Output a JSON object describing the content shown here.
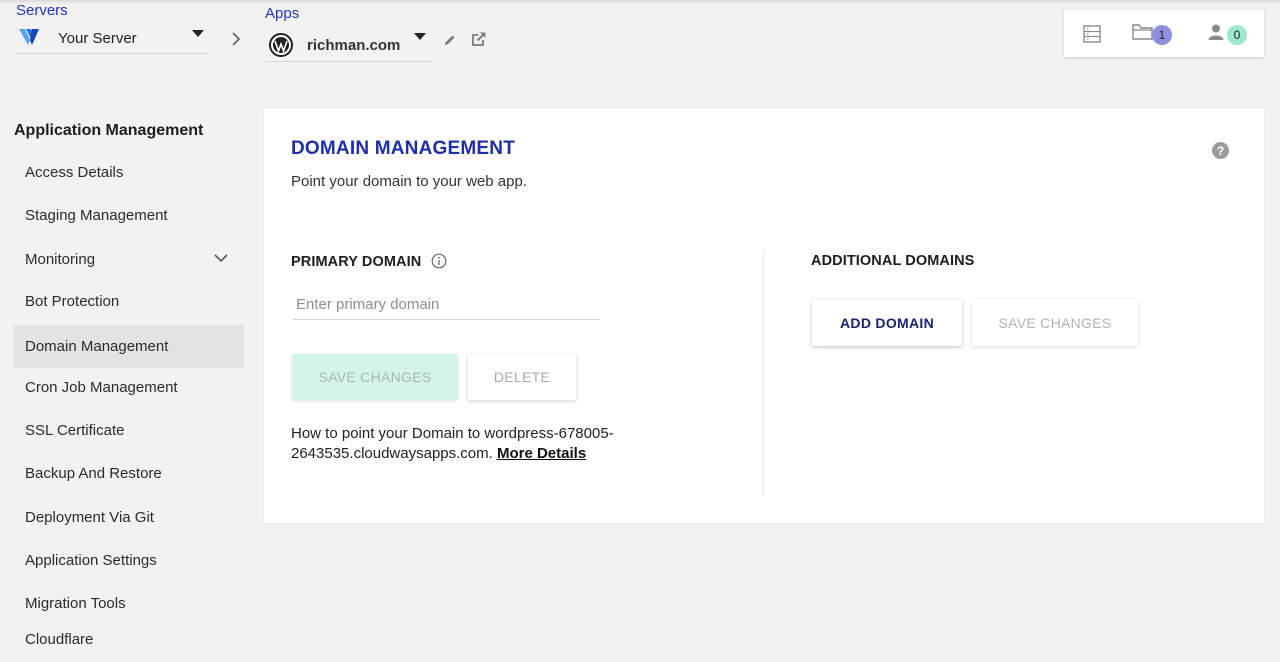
{
  "header": {
    "servers": {
      "label": "Servers",
      "value": "Your Server",
      "logo": "vultr-v-logo"
    },
    "apps": {
      "label": "Apps",
      "value": "richman.com",
      "logo": "wordpress-logo"
    },
    "widget": {
      "server_icon": "server-list-icon",
      "folder_count": "1",
      "users_count": "0",
      "folder_badge_color": "#8f8fe0",
      "users_badge_color": "#9ee8cf"
    }
  },
  "sidebar": {
    "title": "Application Management",
    "items": [
      {
        "label": "Access Details"
      },
      {
        "label": "Staging Management"
      },
      {
        "label": "Monitoring"
      },
      {
        "label": "Bot Protection"
      },
      {
        "label": "Domain Management"
      },
      {
        "label": "Cron Job Management"
      },
      {
        "label": "SSL Certificate"
      },
      {
        "label": "Backup And Restore"
      },
      {
        "label": "Deployment Via Git"
      },
      {
        "label": "Application Settings"
      },
      {
        "label": "Migration Tools"
      },
      {
        "label": "Cloudflare"
      }
    ]
  },
  "main": {
    "title": "DOMAIN MANAGEMENT",
    "subtitle": "Point your domain to your web app.",
    "primary": {
      "title": "PRIMARY DOMAIN",
      "placeholder": "Enter primary domain",
      "save_label": "SAVE CHANGES",
      "delete_label": "DELETE",
      "howto_text": "How to point your Domain to wordpress-678005-2643535.cloudwaysapps.com.",
      "more_details": "More Details"
    },
    "additional": {
      "title": "ADDITIONAL DOMAINS",
      "add_label": "ADD DOMAIN",
      "save_label": "SAVE CHANGES"
    }
  },
  "colors": {
    "accent": "#1f2fa8",
    "label_blue": "#2136b8",
    "save_green_bg": "#d4f4e6",
    "add_text": "#1a2472"
  }
}
